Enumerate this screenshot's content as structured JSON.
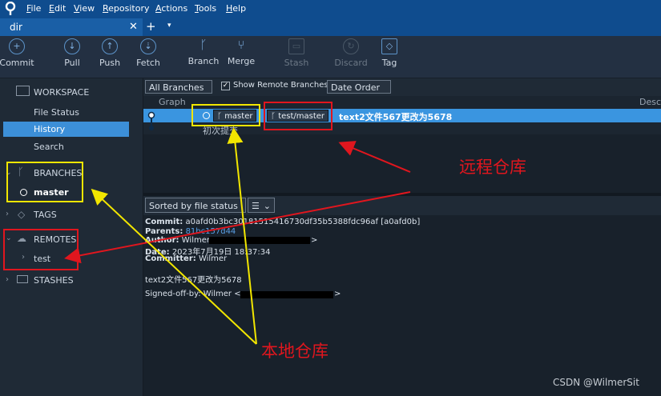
{
  "menu": [
    "File",
    "Edit",
    "View",
    "Repository",
    "Actions",
    "Tools",
    "Help"
  ],
  "menu_mnemonics": [
    "F",
    "E",
    "V",
    "R",
    "A",
    "T",
    "H"
  ],
  "tab": {
    "label": "dir",
    "close": "✕",
    "add": "+",
    "more": "▾"
  },
  "toolbar": {
    "commit": "Commit",
    "pull": "Pull",
    "push": "Push",
    "fetch": "Fetch",
    "branch": "Branch",
    "merge": "Merge",
    "stash": "Stash",
    "discard": "Discard",
    "tag": "Tag"
  },
  "sidebar": {
    "workspace": "WORKSPACE",
    "file_status": "File Status",
    "history": "History",
    "search": "Search",
    "branches": "BRANCHES",
    "branch_master": "master",
    "tags": "TAGS",
    "remotes": "REMOTES",
    "remote_test": "test",
    "stashes": "STASHES"
  },
  "filters": {
    "branches": "All Branches",
    "show_remote": "Show Remote Branches",
    "order": "Date Order"
  },
  "columns": {
    "graph": "Graph",
    "description": "Desc"
  },
  "commits": [
    {
      "local_branch": "master",
      "remote_branch": "test/master",
      "message": "text2文件567更改为5678"
    },
    {
      "message": "初次提交"
    }
  ],
  "detail": {
    "sort": "Sorted by file status",
    "commit_label": "Commit:",
    "commit_value": "a0afd0b3bc30181515416730df35b5388fdc96af [a0afd0b]",
    "parents_label": "Parents:",
    "parents_value": "81bc157d44",
    "author_label": "Author:",
    "author_value": "Wilmer",
    "date_label": "Date:",
    "date_value": "2023年7月19日 18:37:34",
    "committer_label": "Committer:",
    "committer_value": "Wilmer",
    "message": "text2文件567更改为5678",
    "signoff": "Signed-off-by: Wilmer <",
    "close_angle": ">"
  },
  "annotations": {
    "remote_label": "远程仓库",
    "local_label": "本地仓库",
    "watermark": "CSDN @WilmerSit"
  },
  "colors": {
    "accent": "#3a95e0",
    "yellow": "#f2e600",
    "red": "#e0161e",
    "titlebar": "#0f4c8e"
  }
}
